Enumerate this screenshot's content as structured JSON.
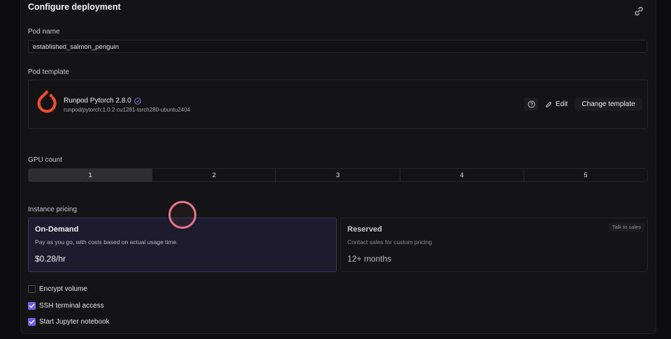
{
  "header": {
    "title": "Configure deployment",
    "link_icon": "link-icon"
  },
  "pod_name": {
    "label": "Pod name",
    "value": "established_salmon_penguin"
  },
  "pod_template": {
    "label": "Pod template",
    "name": "Runpod Pytorch 2.8.0",
    "image": "runpod/pytorch:1.0.2-cu1281-torch280-ubuntu2404",
    "logo_icon": "pytorch-logo-icon",
    "verified_icon": "verified-badge-icon",
    "help_icon": "help-circle-icon",
    "edit_label": "Edit",
    "edit_icon": "pencil-icon",
    "change_label": "Change template"
  },
  "gpu_count": {
    "label": "GPU count",
    "options": [
      "1",
      "2",
      "3",
      "4",
      "5"
    ],
    "selected": "1"
  },
  "instance_pricing": {
    "label": "Instance pricing",
    "on_demand": {
      "title": "On-Demand",
      "description": "Pay as you go, with costs based on actual usage time.",
      "price": "$0.28/hr",
      "selected": true
    },
    "reserved": {
      "title": "Reserved",
      "description": "Contact sales for custom pricing",
      "term": "12+ months",
      "badge": "Talk to sales",
      "selected": false
    }
  },
  "options": {
    "encrypt_volume": {
      "label": "Encrypt volume",
      "checked": false
    },
    "ssh_terminal": {
      "label": "SSH terminal access",
      "checked": true
    },
    "jupyter": {
      "label": "Start Jupyter notebook",
      "checked": true
    }
  },
  "colors": {
    "accent": "#6c5ce7",
    "selected_card_bg": "#1e1b2e",
    "pytorch_orange": "#ee4c2c",
    "cursor_ring": "#e67688"
  }
}
